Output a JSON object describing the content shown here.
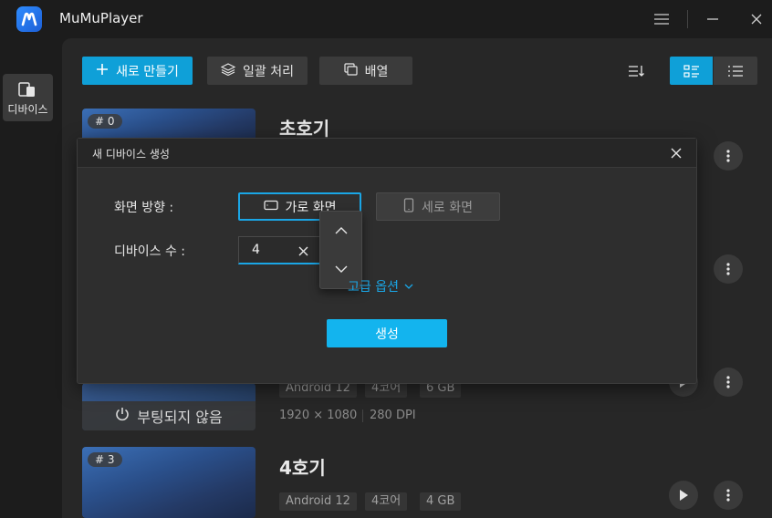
{
  "app": {
    "title": "MuMuPlayer"
  },
  "rail": {
    "devices_label": "디바이스"
  },
  "toolbar": {
    "new_label": "새로 만들기",
    "batch_label": "일괄 처리",
    "arrange_label": "배열"
  },
  "devices": [
    {
      "badge": "# 0",
      "name": "초호기"
    },
    {
      "tags": [
        "Android 12",
        "4코어",
        "6 GB"
      ],
      "resolution": "1920 × 1080",
      "dpi": "280 DPI",
      "boot_status": "부팅되지 않음"
    },
    {
      "badge": "# 3",
      "name": "4호기",
      "tags": [
        "Android 12",
        "4코어",
        "4 GB"
      ]
    }
  ],
  "modal": {
    "title": "새 디바이스 생성",
    "orientation_label": "화면 방향 :",
    "landscape_label": "가로 화면",
    "portrait_label": "세로 화면",
    "count_label": "디바이스 수 :",
    "count_value": "4",
    "advanced_label": "고급 옵션",
    "create_label": "생성"
  },
  "colors": {
    "accent": "#13b4ee",
    "panel": "#272727",
    "background": "#1c1c1c"
  }
}
